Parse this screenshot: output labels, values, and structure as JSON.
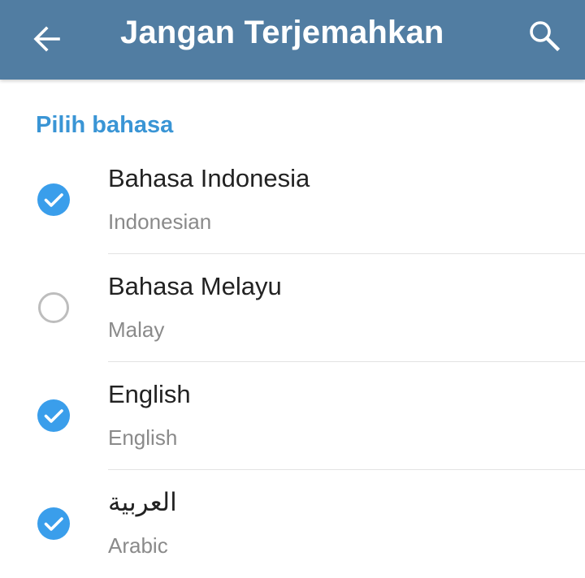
{
  "appbar": {
    "title": "Jangan Terjemahkan",
    "back_icon": "arrow-left-icon",
    "search_icon": "search-icon",
    "background_color": "#517da2"
  },
  "section": {
    "header": "Pilih bahasa",
    "header_color": "#3a95d5"
  },
  "languages": [
    {
      "name": "Bahasa Indonesia",
      "subtitle": "Indonesian",
      "checked": true
    },
    {
      "name": "Bahasa Melayu",
      "subtitle": "Malay",
      "checked": false
    },
    {
      "name": "English",
      "subtitle": "English",
      "checked": true
    },
    {
      "name": "العربية",
      "subtitle": "Arabic",
      "checked": true
    }
  ],
  "colors": {
    "check_fill": "#3a9eeb",
    "unchecked_ring": "#bdbdbd"
  }
}
